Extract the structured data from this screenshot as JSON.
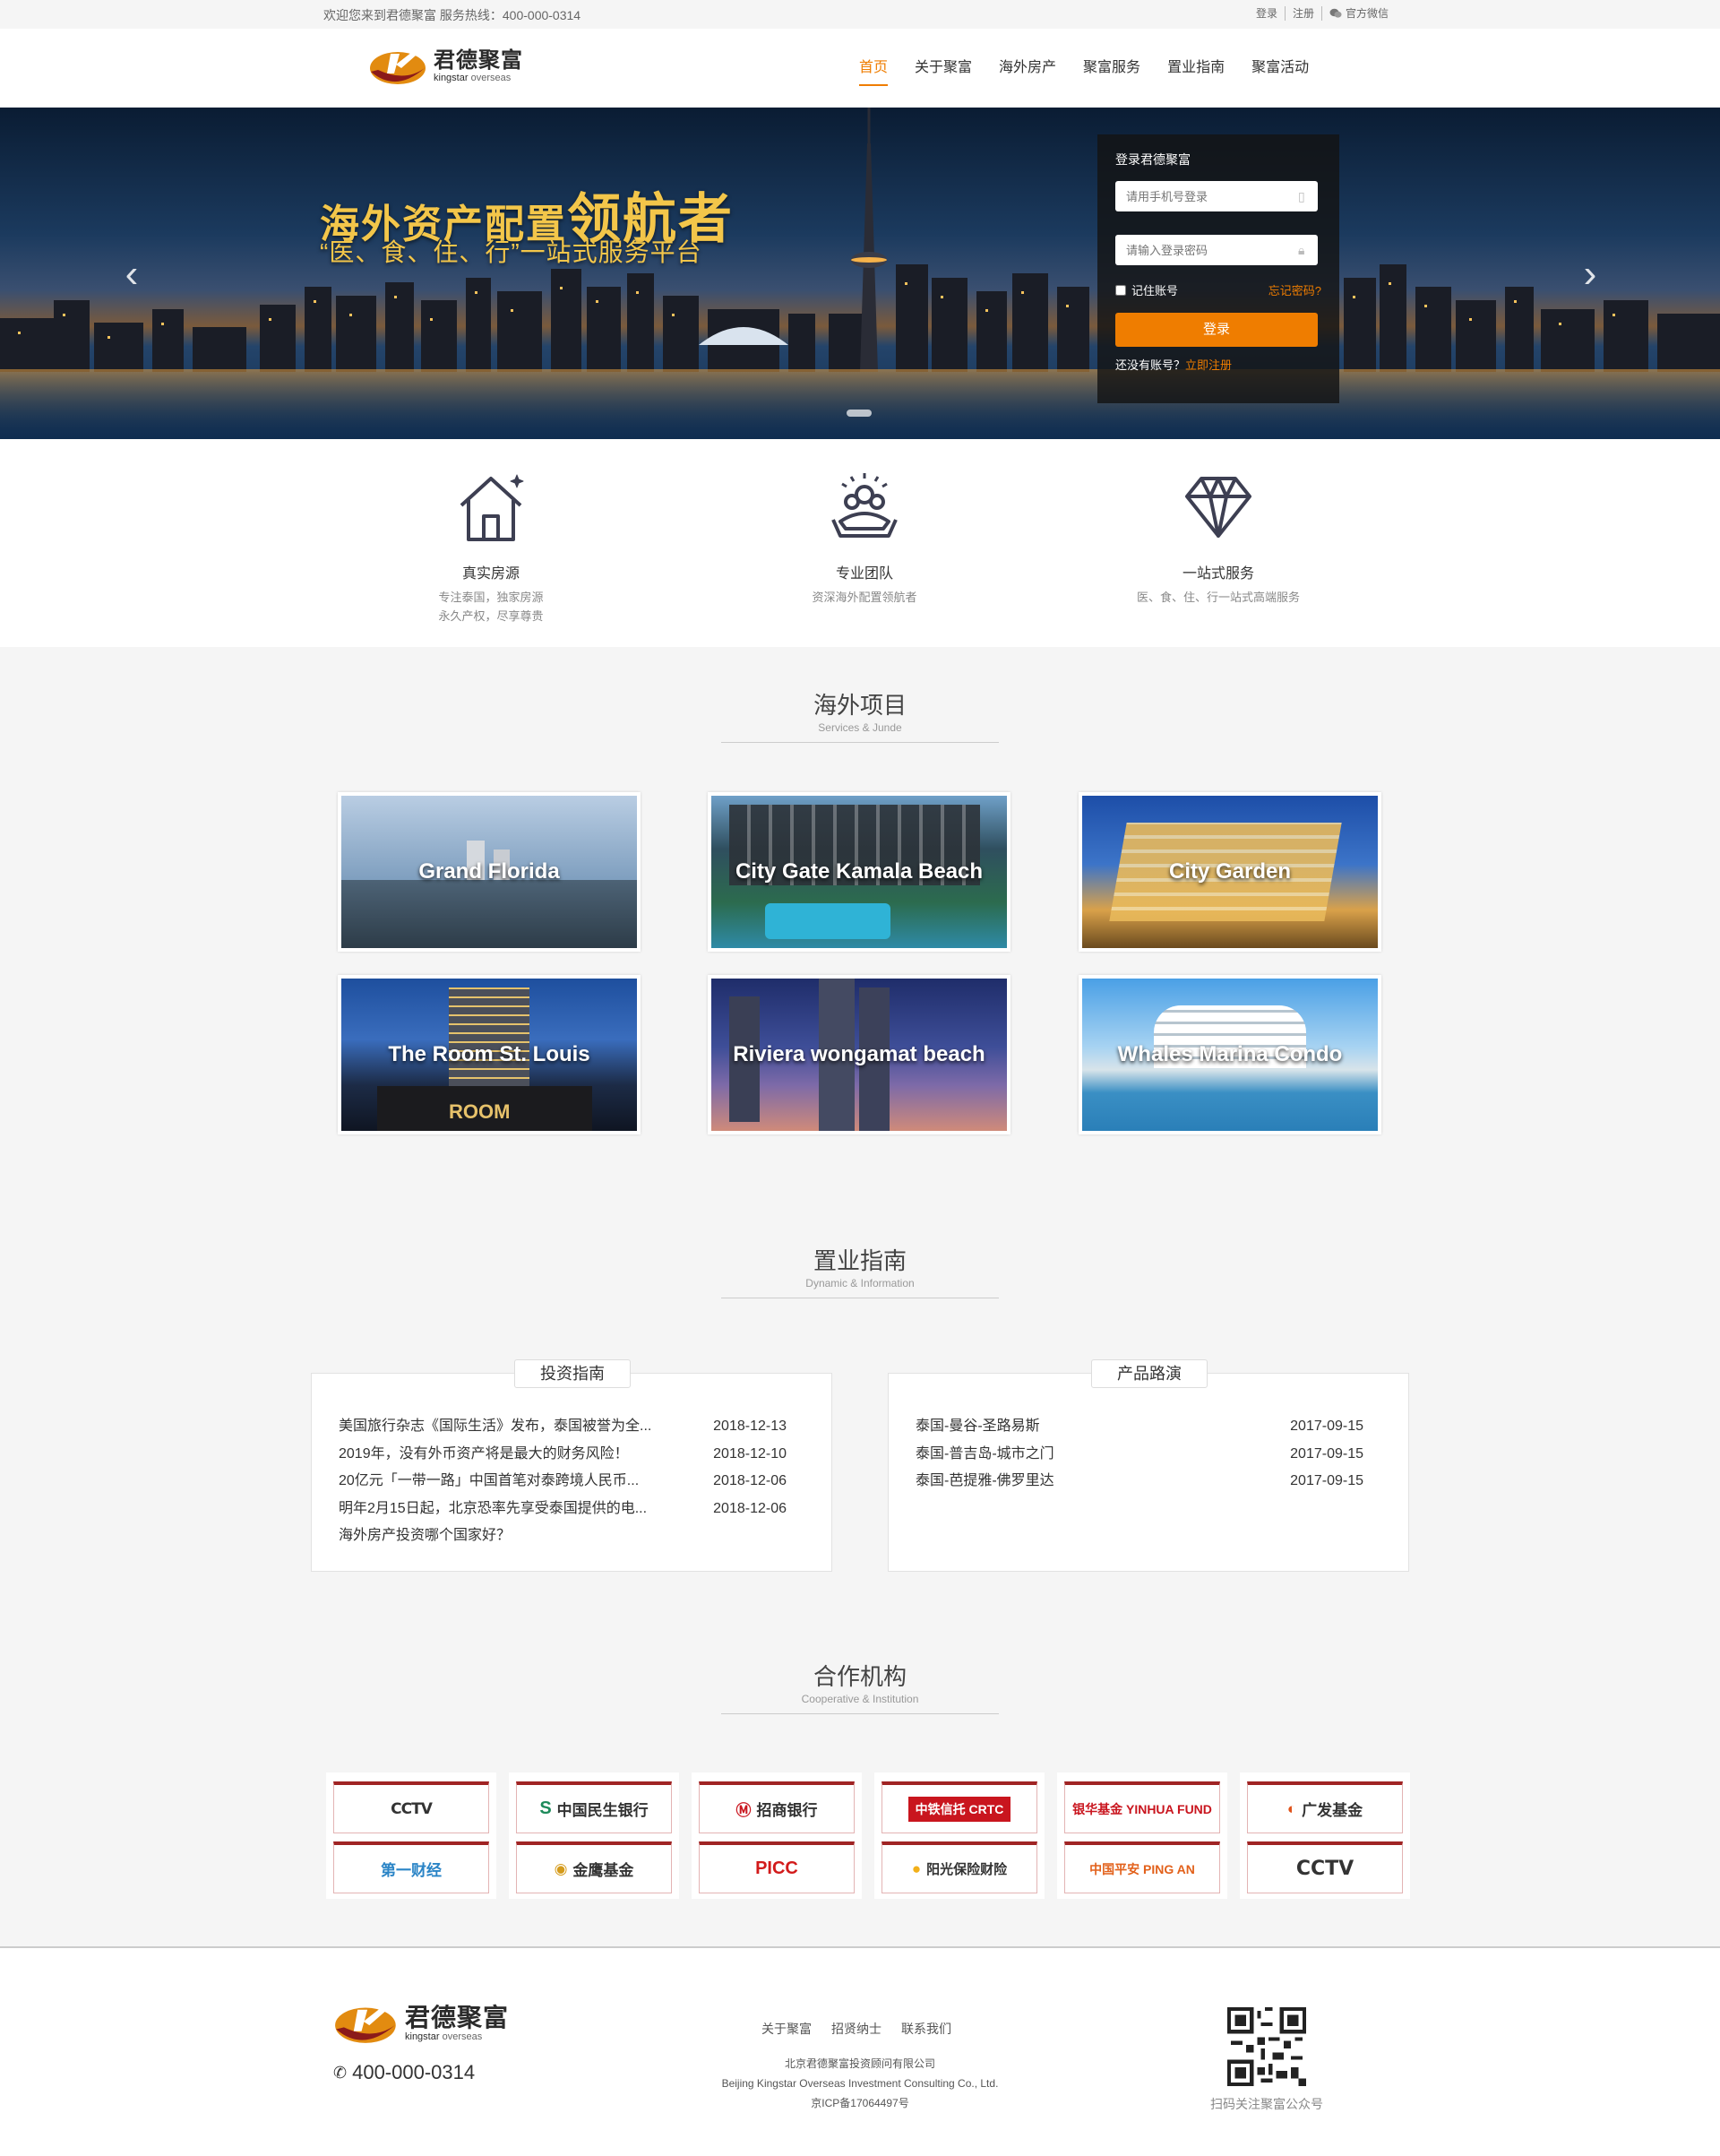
{
  "topbar": {
    "welcome": "欢迎您来到君德聚富 服务热线：400-000-0314",
    "login": "登录",
    "register": "注册",
    "wechat": "官方微信"
  },
  "brand": {
    "name_cn": "君德聚富",
    "name_en_a": "kingstar",
    "name_en_b": "overseas"
  },
  "nav": [
    "首页",
    "关于聚富",
    "海外房产",
    "聚富服务",
    "置业指南",
    "聚富活动"
  ],
  "banner": {
    "slogan_a": "海外资产配置",
    "slogan_b": "领航者",
    "subslogan": "“医、食、住、行”一站式服务平台"
  },
  "login": {
    "title": "登录君德聚富",
    "phone_placeholder": "请用手机号登录",
    "password_placeholder": "请输入登录密码",
    "remember": "记住账号",
    "forget": "忘记密码?",
    "submit": "登录",
    "no_account": "还没有账号？",
    "register_now": "立即注册"
  },
  "features": [
    {
      "icon": "house-icon",
      "title": "真实房源",
      "desc1": "专注泰国，独家房源",
      "desc2": "永久产权，尽享尊贵"
    },
    {
      "icon": "team-icon",
      "title": "专业团队",
      "desc1": "资深海外配置领航者",
      "desc2": ""
    },
    {
      "icon": "diamond-icon",
      "title": "一站式服务",
      "desc1": "医、食、住、行一站式高端服务",
      "desc2": ""
    }
  ],
  "projects_section": {
    "title": "海外项目",
    "subtitle": "Services & Junde"
  },
  "projects": [
    "Grand Florida",
    "City Gate Kamala Beach",
    "City Garden",
    "The Room St. Louis",
    "Riviera wongamat beach",
    "Whales Marina Condo"
  ],
  "guide_section": {
    "title": "置业指南",
    "subtitle": "Dynamic & Information"
  },
  "guide": {
    "invest": {
      "tag": "投资指南",
      "items": [
        {
          "title": "美国旅行杂志《国际生活》发布，泰国被誉为全...",
          "date": "2018-12-13"
        },
        {
          "title": "2019年，没有外币资产将是最大的财务风险！",
          "date": "2018-12-10"
        },
        {
          "title": "20亿元「一带一路」中国首笔对泰跨境人民币...",
          "date": "2018-12-06"
        },
        {
          "title": "明年2月15日起，北京恐率先享受泰国提供的电...",
          "date": "2018-12-06"
        },
        {
          "title": "海外房产投资哪个国家好？",
          "date": ""
        }
      ]
    },
    "roadshow": {
      "tag": "产品路演",
      "items": [
        {
          "title": "泰国-曼谷-圣路易斯",
          "date": "2017-09-15"
        },
        {
          "title": "泰国-普吉岛-城市之门",
          "date": "2017-09-15"
        },
        {
          "title": "泰国-芭提雅-佛罗里达",
          "date": "2017-09-15"
        }
      ]
    }
  },
  "partners_section": {
    "title": "合作机构",
    "subtitle": "Cooperative & Institution"
  },
  "partners": [
    [
      "CCTV",
      "第一财经"
    ],
    [
      "中国民生银行",
      "金鹰基金"
    ],
    [
      "招商银行",
      "PICC"
    ],
    [
      "中铁信托 CRTC",
      "阳光保险财险"
    ],
    [
      "银华基金 YINHUA FUND",
      "中国平安 PING AN"
    ],
    [
      "广发基金",
      "CCTV"
    ]
  ],
  "footer": {
    "phone": "400-000-0314",
    "links": [
      "关于聚富",
      "招贤纳士",
      "联系我们"
    ],
    "company_cn": "北京君德聚富投资顾问有限公司",
    "company_en": "Beijing Kingstar Overseas Investment Consulting Co., Ltd.",
    "icp": "京ICP备17064497号",
    "qr_caption": "扫码关注聚富公众号"
  },
  "colors": {
    "accent": "#ef7d00",
    "partner_red": "#a02424"
  }
}
